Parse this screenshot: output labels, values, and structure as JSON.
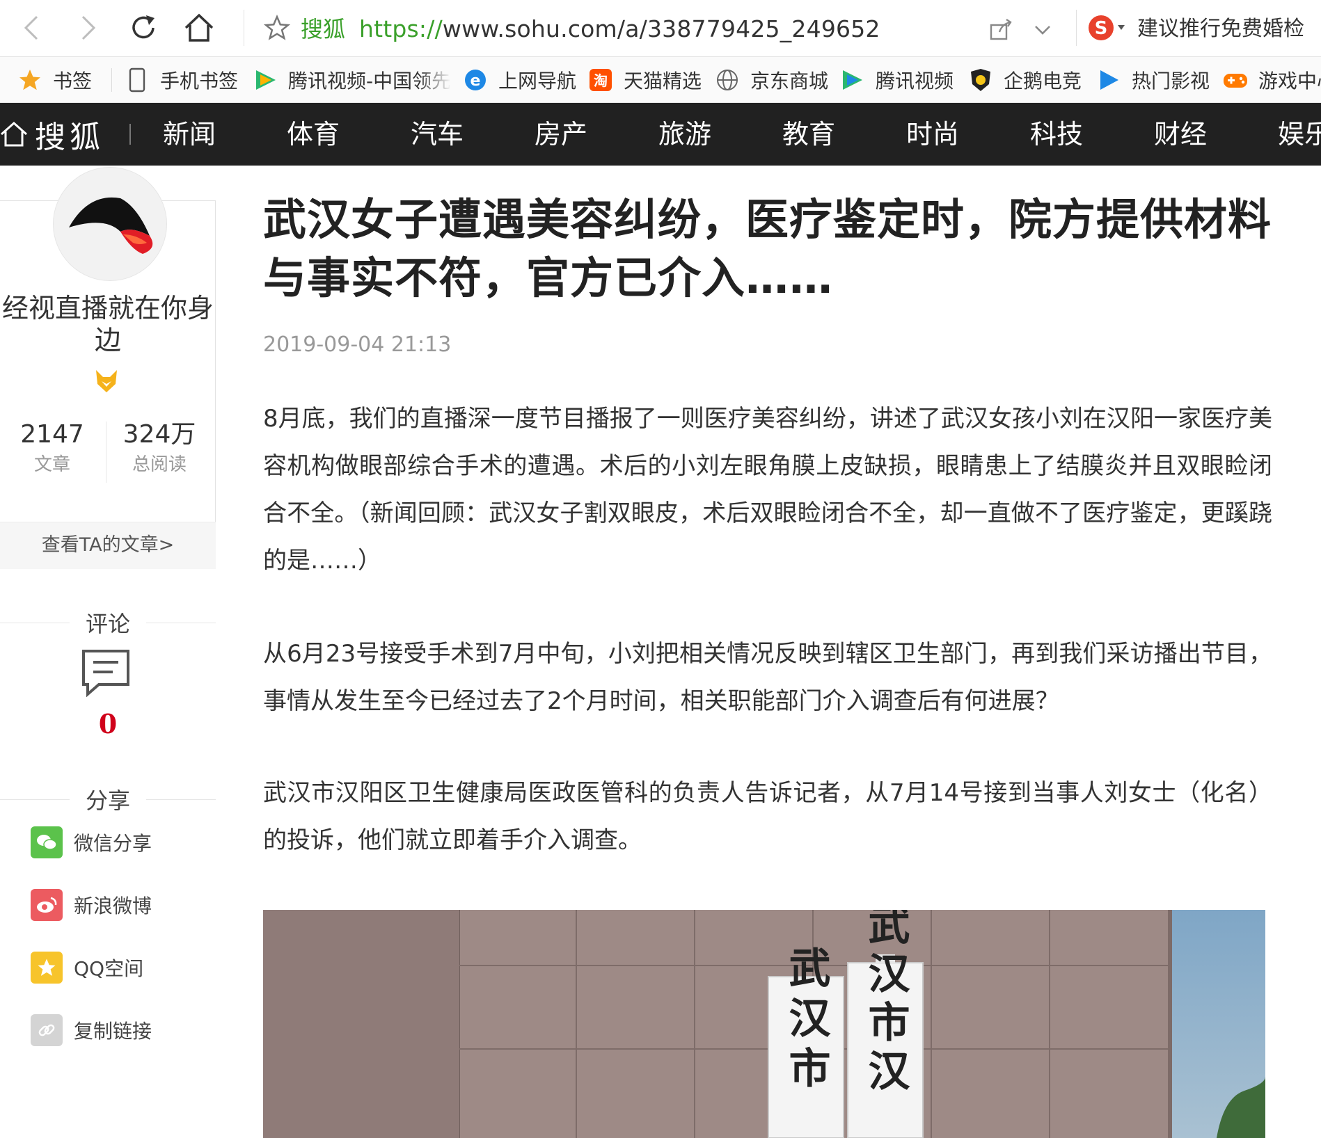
{
  "browser": {
    "site_tag": "搜狐",
    "url_protocol": "https://",
    "url_rest": "www.sohu.com/a/338779425_249652",
    "promo_text": "建议推行免费婚检"
  },
  "bookmarks": [
    {
      "label": "书签",
      "icon": "star-icon",
      "color": "#f5a623"
    },
    {
      "label": "手机书签",
      "icon": "phone-icon",
      "color": "#555555"
    },
    {
      "label": "腾讯视频-中国领先",
      "icon": "tencent-video-icon",
      "color": "#2ab76f"
    },
    {
      "label": "上网导航",
      "icon": "ie-icon",
      "color": "#1e88e5"
    },
    {
      "label": "天猫精选",
      "icon": "tmall-icon",
      "color": "#ff5000"
    },
    {
      "label": "京东商城",
      "icon": "globe-icon",
      "color": "#666666"
    },
    {
      "label": "腾讯视频",
      "icon": "tencent-video-icon",
      "color": "#2ab76f"
    },
    {
      "label": "企鹅电竞",
      "icon": "penguin-esports-icon",
      "color": "#222222"
    },
    {
      "label": "热门影视",
      "icon": "play-icon",
      "color": "#1e88e5"
    },
    {
      "label": "游戏中心",
      "icon": "gamepad-icon",
      "color": "#ff7a00"
    }
  ],
  "nav": {
    "logo": "搜狐",
    "items": [
      "新闻",
      "体育",
      "汽车",
      "房产",
      "旅游",
      "教育",
      "时尚",
      "科技",
      "财经",
      "娱乐"
    ]
  },
  "author": {
    "name": "经视直播就在你身边",
    "articles_count": "2147",
    "articles_label": "文章",
    "reads_count": "324万",
    "reads_label": "总阅读",
    "view_link": "查看TA的文章>"
  },
  "comments": {
    "title": "评论",
    "count": "0"
  },
  "share": {
    "title": "分享",
    "items": [
      {
        "label": "微信分享",
        "icon": "wechat-icon",
        "color": "#5bc24b"
      },
      {
        "label": "新浪微博",
        "icon": "weibo-icon",
        "color": "#ec5b60"
      },
      {
        "label": "QQ空间",
        "icon": "qzone-icon",
        "color": "#f7c42b"
      },
      {
        "label": "复制链接",
        "icon": "link-icon",
        "color": "#d4d4d4"
      }
    ]
  },
  "article": {
    "title": "武汉女子遭遇美容纠纷，医疗鉴定时，院方提供材料与事实不符，官方已介入……",
    "time": "2019-09-04 21:13",
    "paragraphs": [
      "8月底，我们的直播深一度节目播报了一则医疗美容纠纷，讲述了武汉女孩小刘在汉阳一家医疗美容机构做眼部综合手术的遭遇。术后的小刘左眼角膜上皮缺损，眼睛患上了结膜炎并且双眼睑闭合不全。（新闻回顾：武汉女子割双眼皮，术后双眼睑闭合不全，却一直做不了医疗鉴定，更蹊跷的是……）",
      "从6月23号接受手术到7月中旬，小刘把相关情况反映到辖区卫生部门，再到我们采访播出节目，事情从发生至今已经过去了2个月时间，相关职能部门介入调查后有何进展？",
      "武汉市汉阳区卫生健康局医政医管科的负责人告诉记者，从7月14号接到当事人刘女士（化名）的投诉，他们就立即着手介入调查。"
    ],
    "image_sign_left": "武汉市",
    "image_sign_right": "武汉市汉"
  }
}
